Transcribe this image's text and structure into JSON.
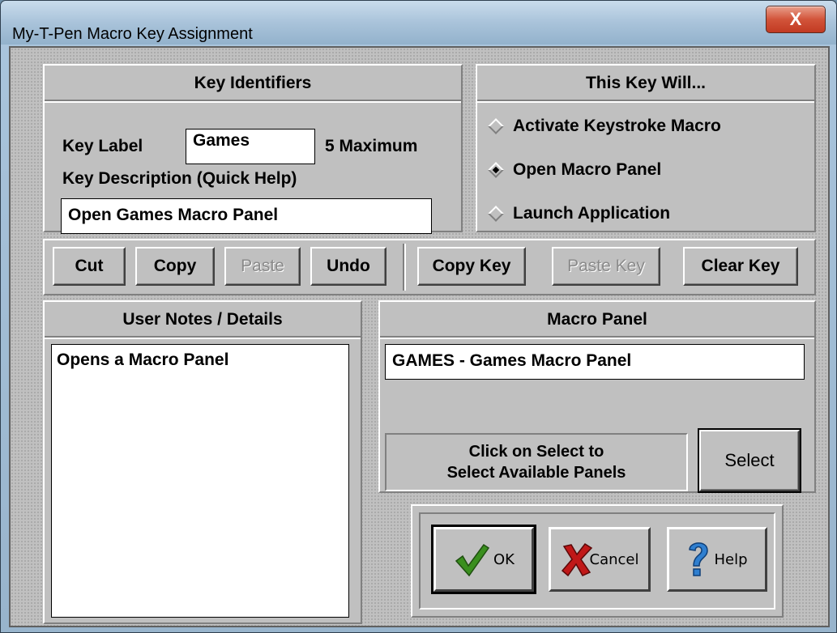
{
  "window": {
    "title": "My-T-Pen Macro Key Assignment",
    "close_glyph": "X"
  },
  "key_identifiers": {
    "heading": "Key Identifiers",
    "key_label_caption": "Key Label",
    "key_label_value": "Games",
    "max_hint": "5 Maximum",
    "description_caption": "Key Description (Quick Help)",
    "description_value": "Open Games Macro Panel"
  },
  "key_action": {
    "heading": "This Key Will...",
    "options": [
      {
        "label": "Activate Keystroke Macro",
        "selected": false
      },
      {
        "label": "Open Macro Panel",
        "selected": true
      },
      {
        "label": "Launch Application",
        "selected": false
      }
    ]
  },
  "edit_toolbar": {
    "cut": "Cut",
    "copy": "Copy",
    "paste": "Paste",
    "undo": "Undo",
    "copy_key": "Copy Key",
    "paste_key": "Paste Key",
    "clear_key": "Clear Key"
  },
  "user_notes": {
    "heading": "User Notes / Details",
    "text": "Opens a Macro Panel"
  },
  "macro_panel": {
    "heading": "Macro Panel",
    "value": "GAMES - Games Macro Panel",
    "hint_line1": "Click on Select to",
    "hint_line2": "Select Available Panels",
    "select_button": "Select"
  },
  "dialog_buttons": {
    "ok": "OK",
    "cancel": "Cancel",
    "help": "Help"
  },
  "colors": {
    "ok_check": "#3a8f1e",
    "cancel_x": "#c01818",
    "help_q": "#2f7fd0"
  },
  "icons": {
    "ok": "checkmark-icon",
    "cancel": "red-x-icon",
    "help": "question-mark-icon"
  }
}
